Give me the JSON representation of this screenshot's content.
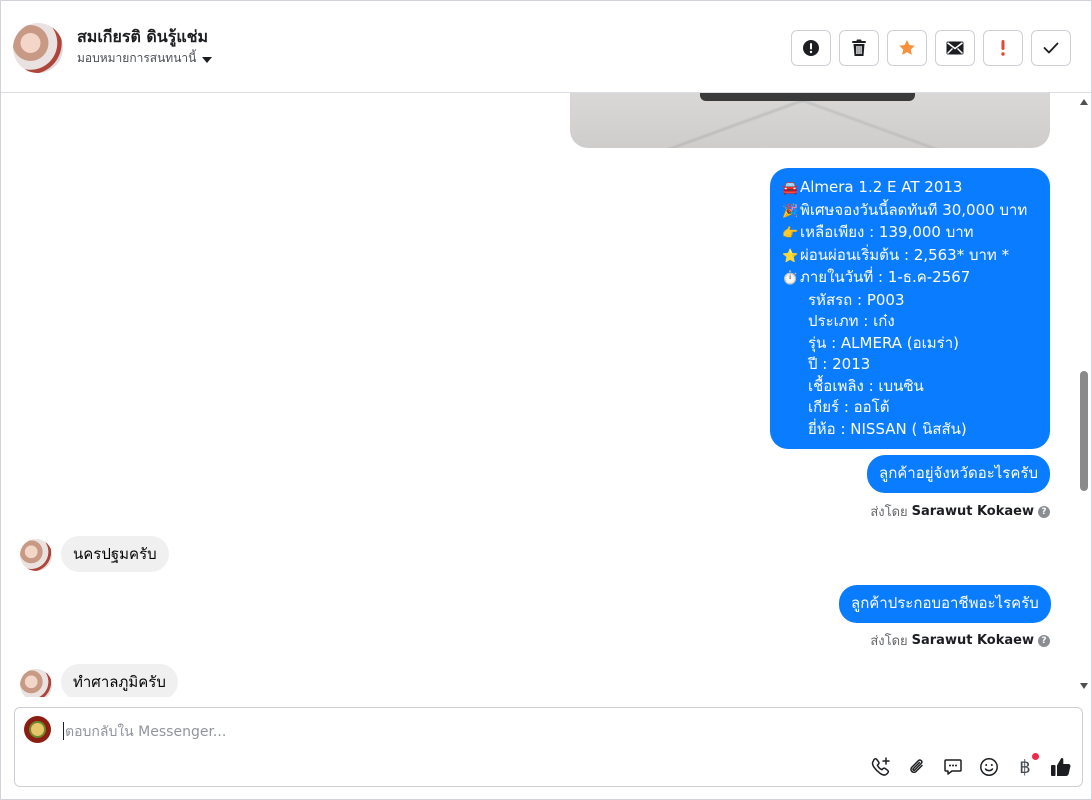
{
  "header": {
    "contact_name": "สมเกียรติ ดินรู้แช่ม",
    "assign_label": "มอบหมายการสนทนานี้",
    "actions": [
      {
        "name": "spam-button",
        "icon": "alert-circle-icon"
      },
      {
        "name": "delete-button",
        "icon": "trash-icon"
      },
      {
        "name": "star-button",
        "icon": "star-icon"
      },
      {
        "name": "mark-unread-button",
        "icon": "envelope-icon"
      },
      {
        "name": "follow-up-button",
        "icon": "exclamation-icon"
      },
      {
        "name": "done-button",
        "icon": "checkmark-icon"
      }
    ],
    "accent_star": "#f7923a",
    "accent_red": "#e4472f"
  },
  "messages": {
    "listing": {
      "lines": [
        {
          "emoji": "🚘",
          "text": "Almera 1.2 E AT 2013"
        },
        {
          "emoji": "🎉",
          "text": "พิเศษจองวันนี้ลดทันที 30,000 บาท"
        },
        {
          "emoji": "👉",
          "text": "เหลือเพียง : 139,000 บาท"
        },
        {
          "emoji": "⭐",
          "text": "ผ่อนผ่อนเริ่มต้น : 2,563* บาท *"
        },
        {
          "emoji": "⏱️",
          "text": "ภายในวันที่ : 1-ธ.ค-2567"
        },
        {
          "emoji": "",
          "text": "รหัสรถ : P003"
        },
        {
          "emoji": "",
          "text": "ประเภท : เก๋ง"
        },
        {
          "emoji": "",
          "text": "รุ่น : ALMERA (อเมร่า)"
        },
        {
          "emoji": "",
          "text": "ปี : 2013"
        },
        {
          "emoji": "",
          "text": "เชื้อเพลิง : เบนซิน"
        },
        {
          "emoji": "",
          "text": "เกียร์ : ออโต้"
        },
        {
          "emoji": "",
          "text": "ยี่ห้อ : NISSAN ( นิสสัน)"
        }
      ]
    },
    "out_province": "ลูกค้าอยู่จังหวัดอะไรครับ",
    "sent_by_label": "ส่งโดย",
    "sent_by_name": "Sarawut Kokaew",
    "in_province": "นครปฐมครับ",
    "out_job": "ลูกค้าประกอบอาชีพอะไรครับ",
    "in_job": "ทำศาลภูมิครับ",
    "bubble_color": "#0a7cff"
  },
  "composer": {
    "placeholder": "ตอบกลับใน Messenger...",
    "tools": [
      "phone-plus-icon",
      "paperclip-icon",
      "chat-bubble-icon",
      "smiley-icon",
      "baht-icon",
      "thumbs-up-icon"
    ],
    "baht_symbol": "฿"
  }
}
